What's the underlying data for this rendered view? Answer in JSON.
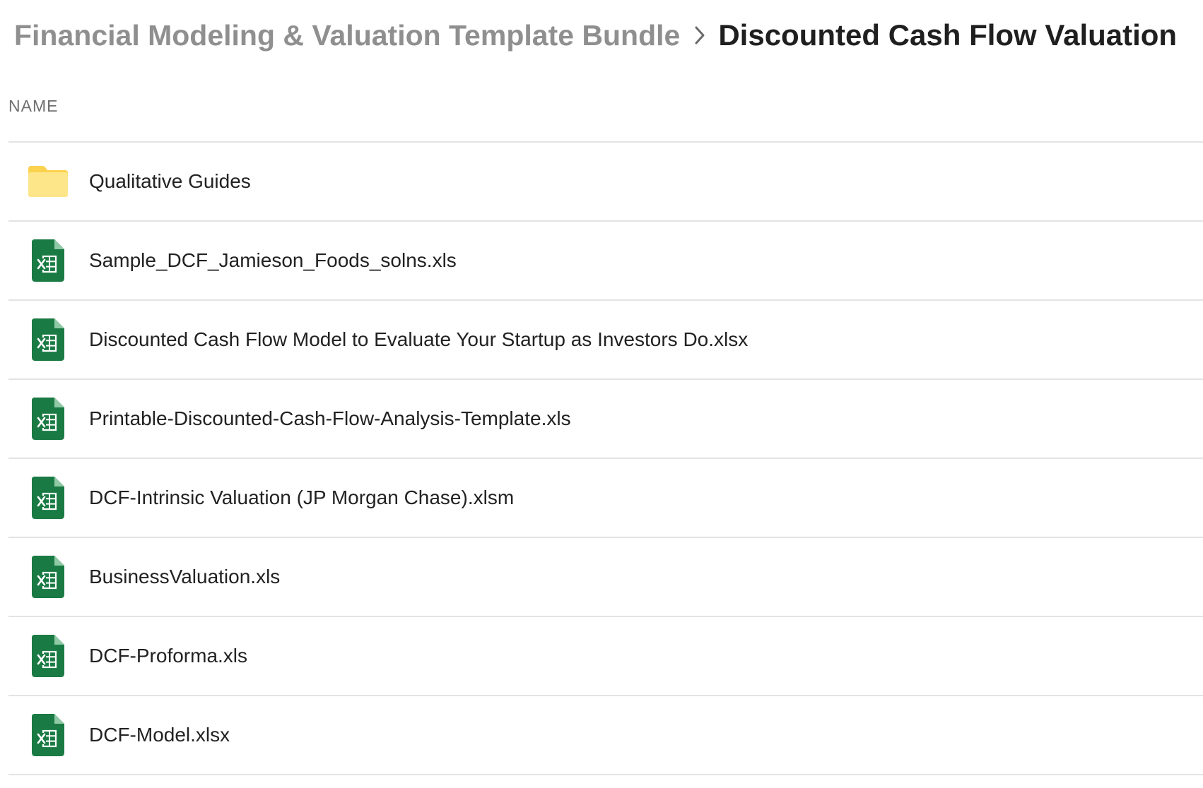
{
  "breadcrumb": {
    "parent": "Financial Modeling & Valuation Template Bundle",
    "current": "Discounted Cash Flow Valuation",
    "separator_icon": "chevron-right-icon"
  },
  "table": {
    "column_header": "NAME"
  },
  "colors": {
    "folder": "#fde68a",
    "folder_tab": "#fbd24e",
    "excel_green": "#1a7a43",
    "excel_fold": "#8fc9a5"
  },
  "items": [
    {
      "type": "folder",
      "icon": "folder-icon",
      "name": "Qualitative Guides"
    },
    {
      "type": "excel",
      "icon": "excel-file-icon",
      "name": "Sample_DCF_Jamieson_Foods_solns.xls"
    },
    {
      "type": "excel",
      "icon": "excel-file-icon",
      "name": "Discounted Cash Flow Model to Evaluate Your Startup as Investors Do.xlsx"
    },
    {
      "type": "excel",
      "icon": "excel-file-icon",
      "name": "Printable-Discounted-Cash-Flow-Analysis-Template.xls"
    },
    {
      "type": "excel",
      "icon": "excel-file-icon",
      "name": "DCF-Intrinsic Valuation (JP Morgan Chase).xlsm"
    },
    {
      "type": "excel",
      "icon": "excel-file-icon",
      "name": "BusinessValuation.xls"
    },
    {
      "type": "excel",
      "icon": "excel-file-icon",
      "name": "DCF-Proforma.xls"
    },
    {
      "type": "excel",
      "icon": "excel-file-icon",
      "name": "DCF-Model.xlsx"
    }
  ]
}
